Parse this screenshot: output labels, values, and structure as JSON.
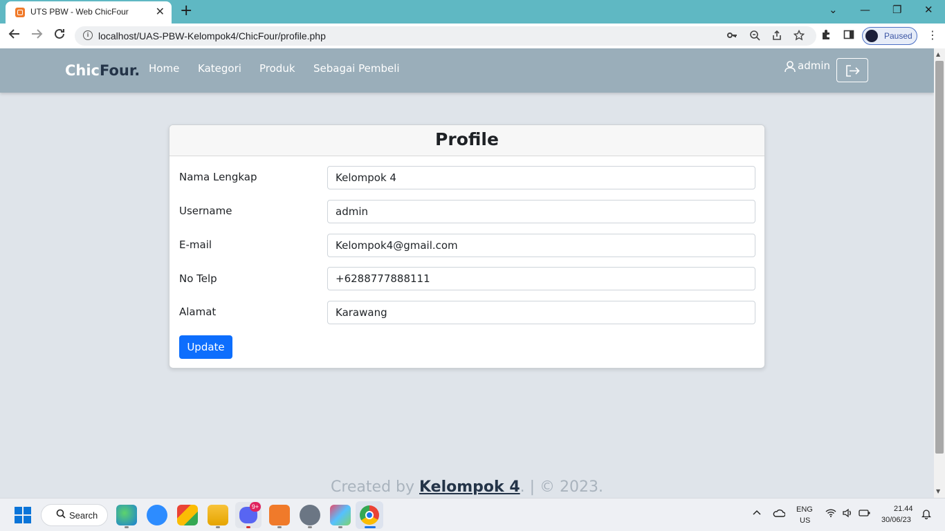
{
  "browser": {
    "tab_title": "UTS PBW - Web ChicFour",
    "tab_close": "✕",
    "new_tab": "+",
    "url": "localhost/UAS-PBW-Kelompok4/ChicFour/profile.php",
    "profile_status": "Paused",
    "window_controls": {
      "minimize": "—",
      "restore": "❐",
      "close": "✕",
      "tab_search": "⌄"
    }
  },
  "site": {
    "brand_part1": "Chic",
    "brand_part2": "Four.",
    "nav": {
      "home": "Home",
      "kategori": "Kategori",
      "produk": "Produk",
      "sebagai_pembeli": "Sebagai Pembeli"
    },
    "user": "admin"
  },
  "profile": {
    "title": "Profile",
    "fields": [
      {
        "label": "Nama Lengkap",
        "value": "Kelompok 4"
      },
      {
        "label": "Username",
        "value": "admin"
      },
      {
        "label": "E-mail",
        "value": "Kelompok4@gmail.com"
      },
      {
        "label": "No Telp",
        "value": "+6288777888111"
      },
      {
        "label": "Alamat",
        "value": "Karawang"
      }
    ],
    "update_label": "Update"
  },
  "footer": {
    "prefix": "Created by ",
    "author": "Kelompok 4",
    "suffix": ". | © 2023."
  },
  "taskbar": {
    "search_label": "Search",
    "discord_badge": "9+",
    "lang_top": "ENG",
    "lang_bottom": "US",
    "time": "21.44",
    "date": "30/06/23"
  }
}
